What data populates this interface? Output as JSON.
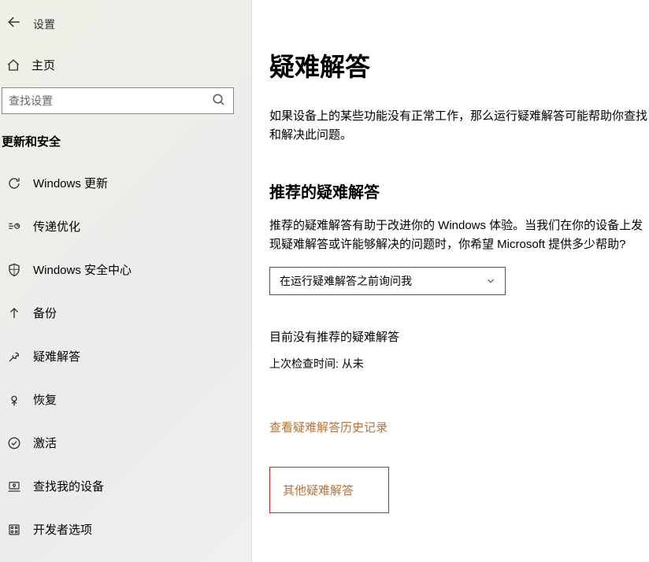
{
  "header": {
    "back_label": "←",
    "title": "设置"
  },
  "home": {
    "label": "主页"
  },
  "search": {
    "placeholder": "查找设置"
  },
  "category": "更新和安全",
  "nav": [
    {
      "icon": "sync",
      "label": "Windows 更新"
    },
    {
      "icon": "delivery",
      "label": "传递优化"
    },
    {
      "icon": "shield",
      "label": "Windows 安全中心"
    },
    {
      "icon": "backup",
      "label": "备份"
    },
    {
      "icon": "troubleshoot",
      "label": "疑难解答"
    },
    {
      "icon": "recover",
      "label": "恢复"
    },
    {
      "icon": "activate",
      "label": "激活"
    },
    {
      "icon": "findmy",
      "label": "查找我的设备"
    },
    {
      "icon": "dev",
      "label": "开发者选项"
    }
  ],
  "main": {
    "title": "疑难解答",
    "intro": "如果设备上的某些功能没有正常工作，那么运行疑难解答可能帮助你查找和解决此问题。",
    "recommend_heading": "推荐的疑难解答",
    "recommend_desc": "推荐的疑难解答有助于改进你的 Windows 体验。当我们在你的设备上发现疑难解答或许能够解决的问题时，你希望 Microsoft 提供多少帮助?",
    "dropdown_value": "在运行疑难解答之前询问我",
    "status_none": "目前没有推荐的疑难解答",
    "last_check": "上次检查时间: 从未",
    "history_link": "查看疑难解答历史记录",
    "other_title": "其他疑难解答"
  }
}
